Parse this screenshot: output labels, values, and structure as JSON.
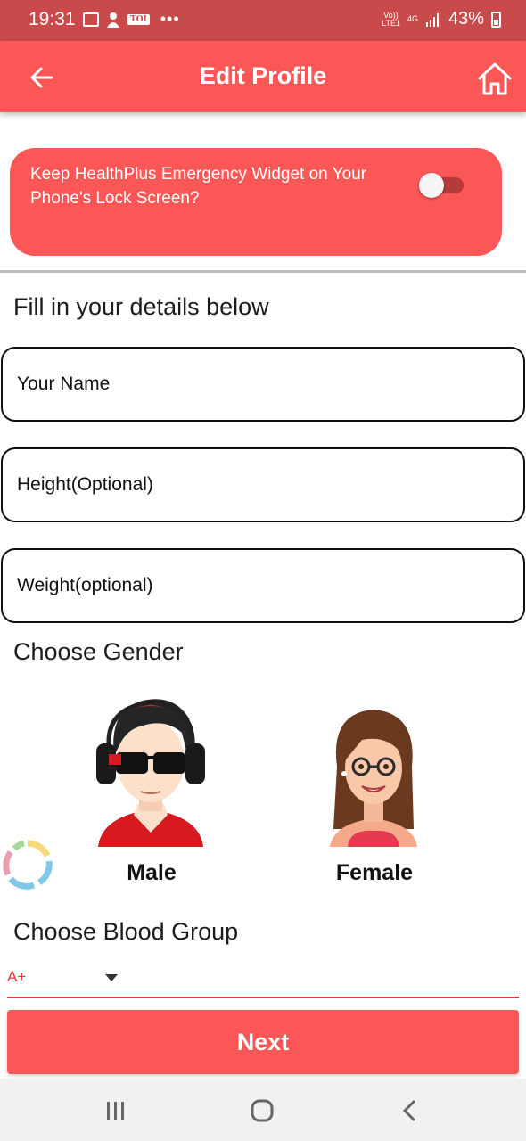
{
  "status_bar": {
    "time": "19:31",
    "battery": "43%",
    "network_top": "Vo))",
    "network_bottom": "LTE1",
    "network_type": "4G",
    "notification_icons": [
      "image-icon",
      "person-icon",
      "toi-icon"
    ],
    "toi_label": "TOI"
  },
  "app_bar": {
    "title": "Edit Profile",
    "back_icon": "arrow-left-icon",
    "home_icon": "home-icon",
    "color": "#fb5757"
  },
  "widget": {
    "text": "Keep HealthPlus Emergency Widget on Your Phone's Lock Screen?",
    "toggle_on": false
  },
  "form": {
    "heading": "Fill in your details below",
    "name_placeholder": "Your Name",
    "height_placeholder": "Height(Optional)",
    "weight_placeholder": "Weight(optional)"
  },
  "gender": {
    "heading": "Choose Gender",
    "male_label": "Male",
    "female_label": "Female"
  },
  "blood": {
    "heading": "Choose Blood Group",
    "selected": "A+"
  },
  "next_label": "Next",
  "nav": {
    "recents_icon": "recents-icon",
    "home_icon": "home-circle-icon",
    "back_icon": "chevron-left-icon"
  },
  "colors": {
    "accent": "#fb5757",
    "status_bar": "#c94a4a",
    "select_text": "#e53935"
  }
}
